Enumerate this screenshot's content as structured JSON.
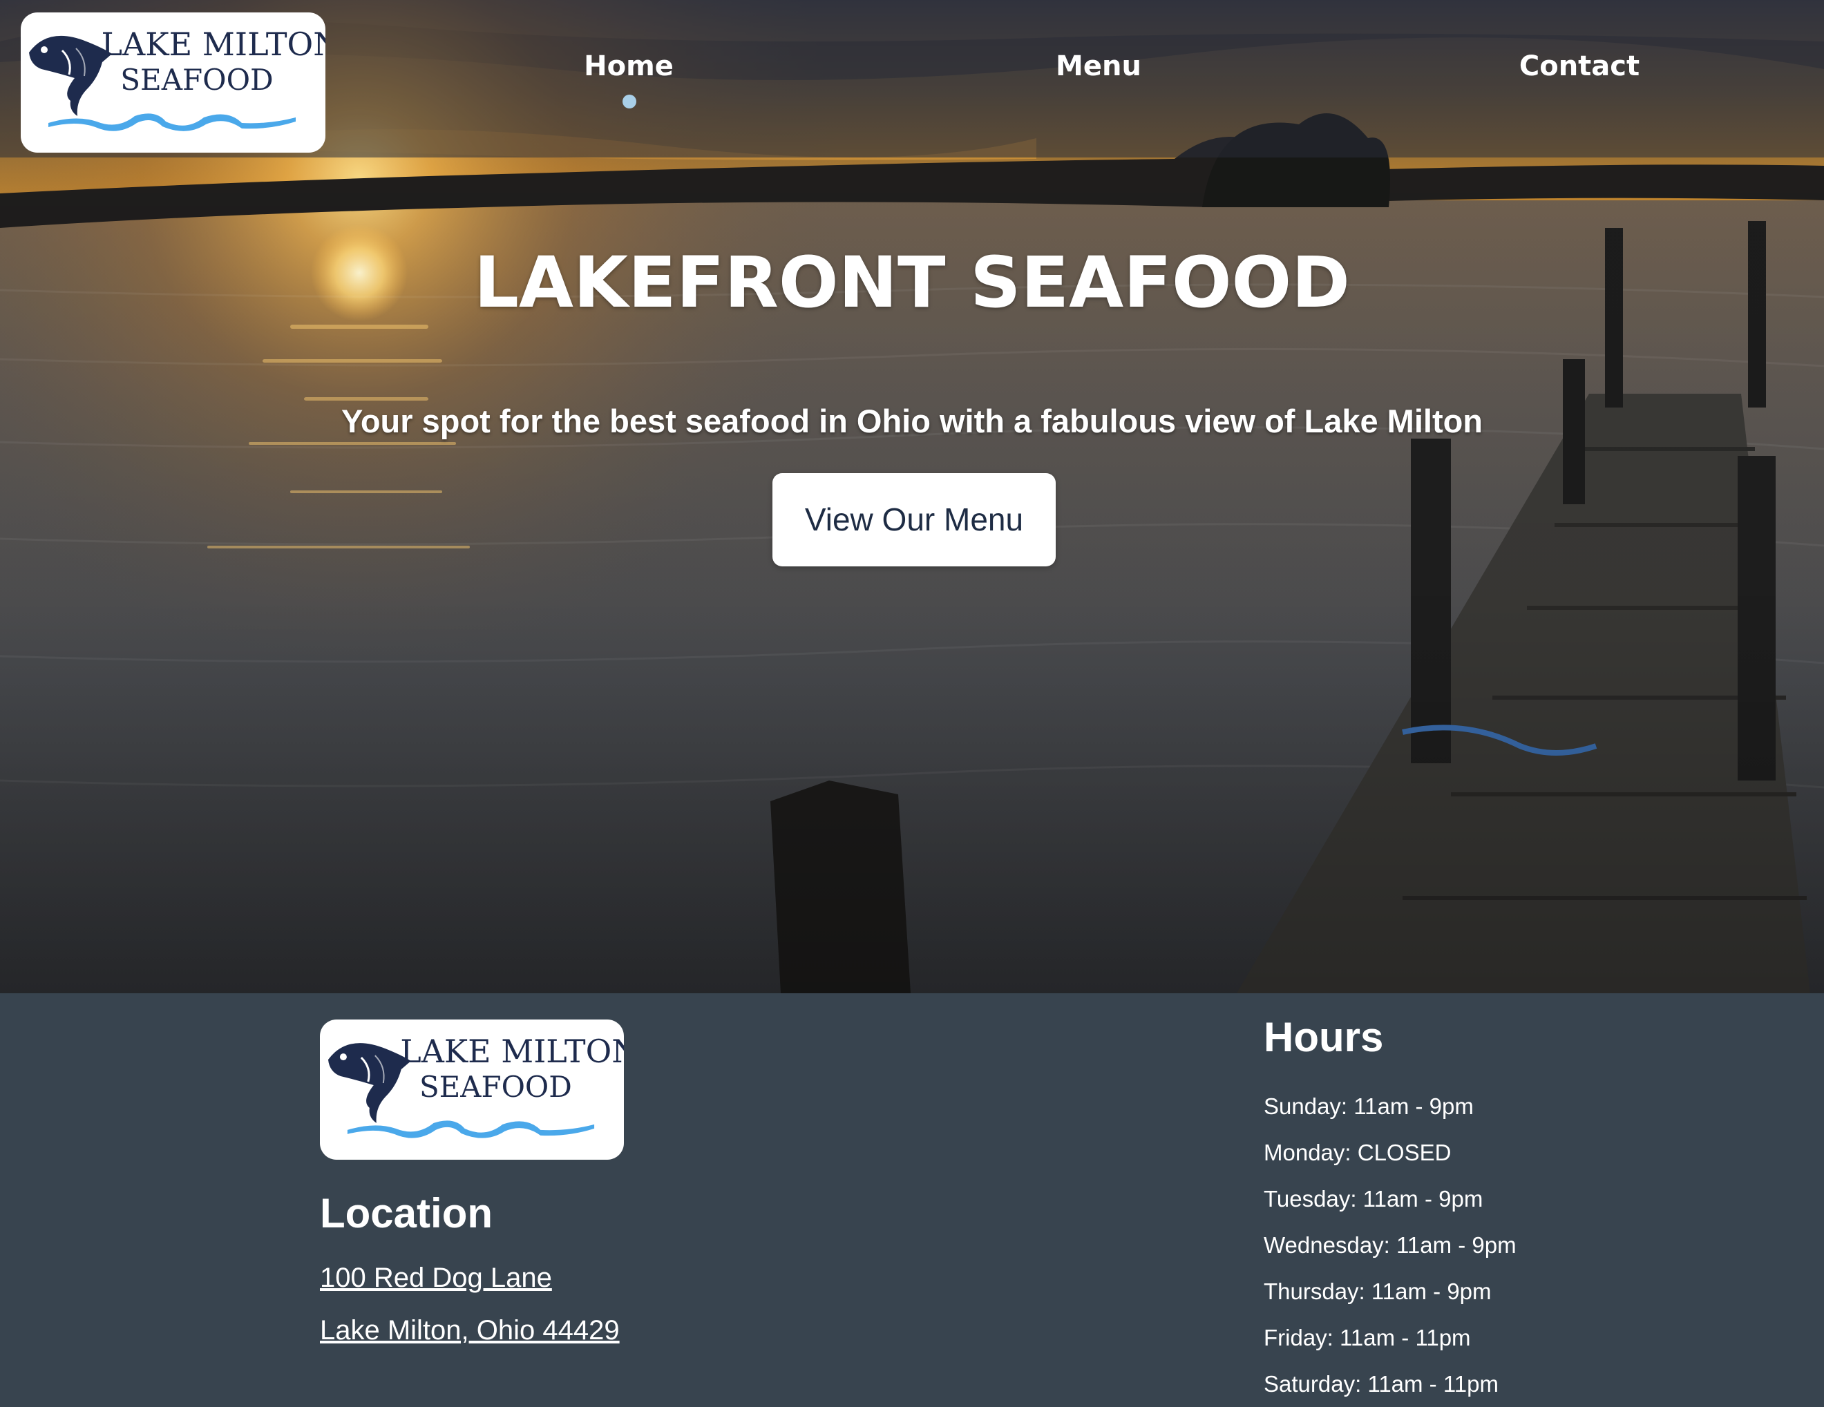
{
  "brand": {
    "logo_line1": "LAKE MILTON",
    "logo_line2": "SEAFOOD",
    "navy": "#1e2b4d",
    "wave_blue": "#4aa8ea"
  },
  "nav": {
    "items": [
      {
        "label": "Home",
        "active": true
      },
      {
        "label": "Menu",
        "active": false
      },
      {
        "label": "Contact",
        "active": false
      }
    ],
    "active_dot_color": "#a9cfe8"
  },
  "hero": {
    "title": "LAKEFRONT SEAFOOD",
    "subtitle": "Your spot for the best seafood in Ohio with a fabulous view of Lake Milton",
    "cta_label": "View Our Menu",
    "image_alt": "Sunset over Lake Milton with a wooden dock"
  },
  "footer": {
    "background": "#38444f",
    "location": {
      "heading": "Location",
      "address_line1": "100 Red Dog Lane",
      "address_line2": "Lake Milton, Ohio 44429"
    },
    "hours": {
      "heading": "Hours",
      "days": [
        "Sunday: 11am - 9pm",
        "Monday: CLOSED",
        "Tuesday: 11am - 9pm",
        "Wednesday: 11am - 9pm",
        "Thursday: 11am - 9pm",
        "Friday: 11am - 11pm",
        "Saturday: 11am - 11pm"
      ]
    }
  }
}
